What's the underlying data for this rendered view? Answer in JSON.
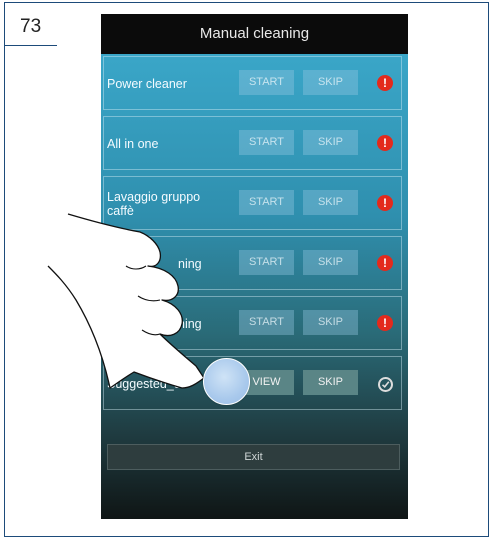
{
  "page_number": "73",
  "screen": {
    "title": "Manual cleaning",
    "rows": [
      {
        "label": "Power cleaner",
        "primary": "START",
        "secondary": "SKIP",
        "status_icon": "alert-icon",
        "status_symbol": "!"
      },
      {
        "label": "All in one",
        "primary": "START",
        "secondary": "SKIP",
        "status_icon": "alert-icon",
        "status_symbol": "!"
      },
      {
        "label": "Lavaggio gruppo caffè",
        "primary": "START",
        "secondary": "SKIP",
        "status_icon": "alert-icon",
        "status_symbol": "!"
      },
      {
        "label": "ning",
        "primary": "START",
        "secondary": "SKIP",
        "status_icon": "alert-icon",
        "status_symbol": "!"
      },
      {
        "label": "ning",
        "primary": "START",
        "secondary": "SKIP",
        "status_icon": "alert-icon",
        "status_symbol": "!"
      },
      {
        "label": "Suggested_cl",
        "primary": "VIEW",
        "secondary": "SKIP",
        "status_icon": "check-icon"
      }
    ],
    "exit_label": "Exit"
  },
  "colors": {
    "alert": "#e32a1c",
    "screen_top": "#3aa6c8",
    "frame_border": "#1d4b7a"
  }
}
